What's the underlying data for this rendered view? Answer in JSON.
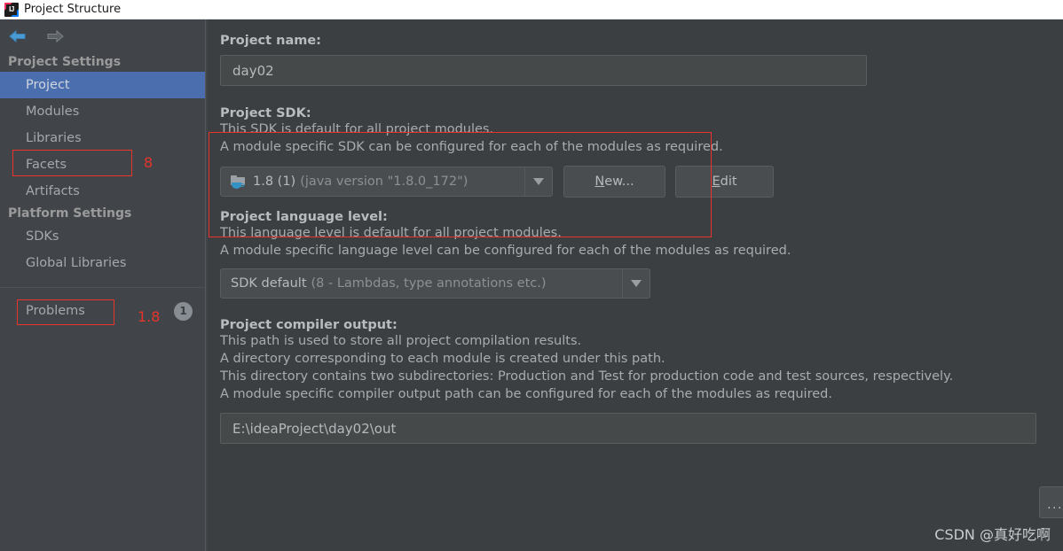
{
  "window": {
    "title": "Project Structure",
    "app_icon": "intellij-idea-icon"
  },
  "toolbar": {
    "back_icon": "arrow-left-icon",
    "forward_icon": "arrow-right-icon"
  },
  "sidebar": {
    "groups": [
      {
        "header": "Project Settings",
        "items": [
          {
            "label": "Project",
            "selected": true
          },
          {
            "label": "Modules",
            "selected": false,
            "annotation_box": true,
            "annotation_text": "8"
          },
          {
            "label": "Libraries",
            "selected": false
          },
          {
            "label": "Facets",
            "selected": false
          },
          {
            "label": "Artifacts",
            "selected": false
          }
        ]
      },
      {
        "header": "Platform Settings",
        "items": [
          {
            "label": "SDKs",
            "selected": false,
            "annotation_box": true,
            "annotation_text": "1.8"
          },
          {
            "label": "Global Libraries",
            "selected": false
          }
        ]
      }
    ],
    "problems": {
      "label": "Problems",
      "count": "1"
    }
  },
  "main": {
    "project_name": {
      "label": "Project name:",
      "value": "day02"
    },
    "project_sdk": {
      "label": "Project SDK:",
      "desc_lines": [
        "This SDK is default for all project modules.",
        "A module specific SDK can be configured for each of the modules as required."
      ],
      "combo_icon": "java-sdk-folder-icon",
      "combo_value": "1.8 (1)",
      "combo_value_detail": "(java version \"1.8.0_172\")",
      "dropdown_icon": "chevron-down-icon",
      "new_button": {
        "mnemonic": "N",
        "rest": "ew..."
      },
      "edit_button": {
        "mnemonic": "E",
        "rest": "dit"
      }
    },
    "project_language_level": {
      "label": "Project language level:",
      "desc_lines": [
        "This language level is default for all project modules.",
        "A module specific language level can be configured for each of the modules as required."
      ],
      "combo_value": "SDK default",
      "combo_value_detail": "(8 - Lambdas, type annotations etc.)",
      "dropdown_icon": "chevron-down-icon"
    },
    "project_compiler_output": {
      "label": "Project compiler output:",
      "desc_lines": [
        "This path is used to store all project compilation results.",
        "A directory corresponding to each module is created under this path.",
        "This directory contains two subdirectories: Production and Test for production code and test sources, respectively.",
        "A module specific compiler output path can be configured for each of the modules as required."
      ],
      "value": "E:\\ideaProject\\day02\\out",
      "browse_button_label": "..."
    }
  },
  "annotations": {
    "color": "#e8342a"
  },
  "watermark": {
    "text": "CSDN @真好吃啊"
  }
}
